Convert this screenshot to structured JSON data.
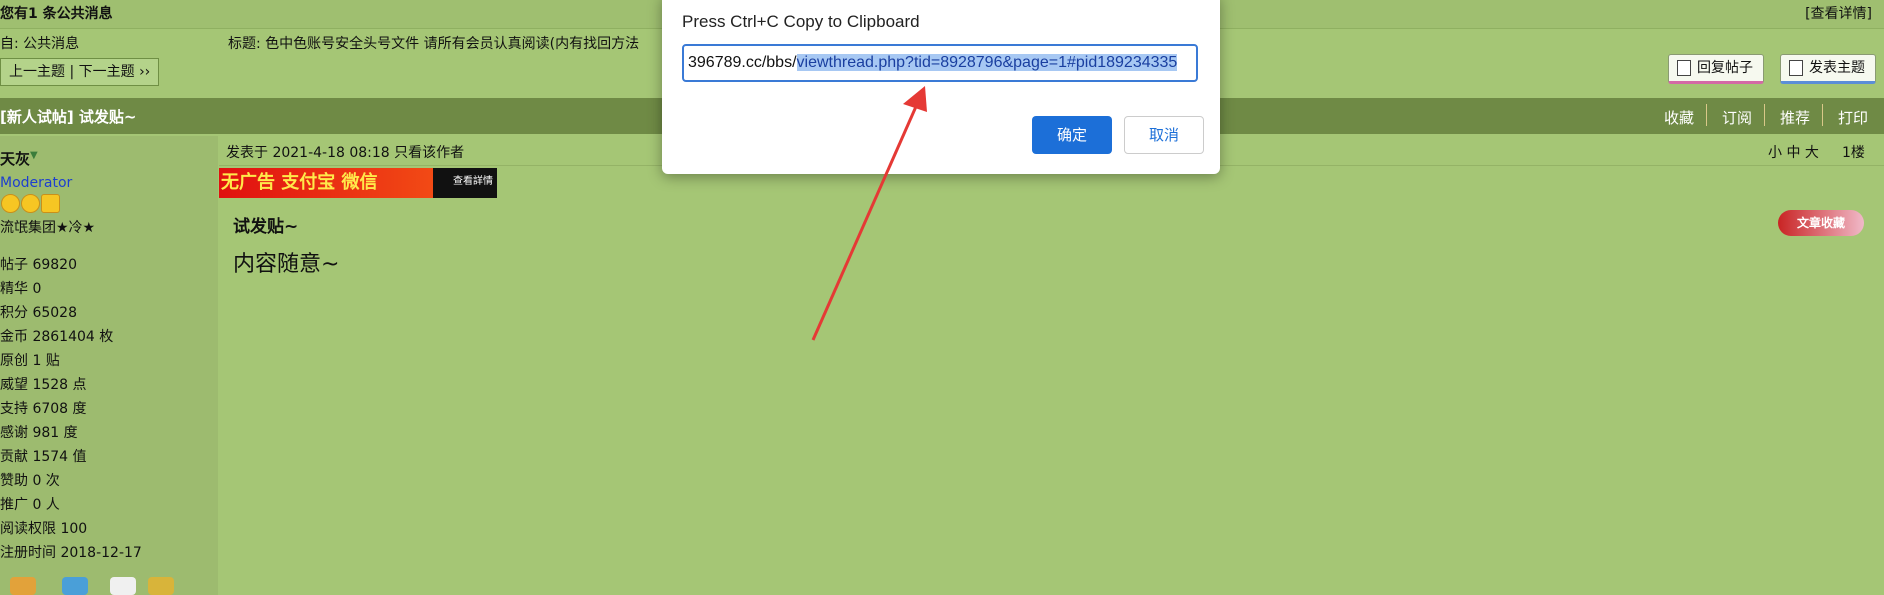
{
  "notice": {
    "title": "您有1 条公共消息",
    "detail": "[查看详情]",
    "from": "自: 公共消息",
    "subject": "标题: 色中色账号安全头号文件 请所有会员认真阅读(内有找回方法",
    "prev_next": "上一主题 | 下一主题 ››"
  },
  "actions": {
    "reply": "回复帖子",
    "post": "发表主题"
  },
  "thread": {
    "title": "[新人试帖] 试发贴~",
    "links": [
      "收藏",
      "订阅",
      "推荐",
      "打印"
    ]
  },
  "user": {
    "name": "天灰",
    "group": "Moderator",
    "team": "流氓集团★冷★",
    "stats": [
      "帖子  69820",
      "精华  0",
      "积分  65028",
      "金币  2861404 枚",
      "原创  1 贴",
      "威望  1528 点",
      "支持  6708 度",
      "感谢  981 度",
      "贡献  1574 值",
      "赞助  0 次",
      "推广  0 人",
      "阅读权限  100",
      "注册时间  2018-12-17"
    ]
  },
  "post": {
    "date": "发表于 2021-4-18 08:18  只看该作者",
    "font_sizes": "小 中 大",
    "floor": "1楼",
    "ad_text": "无广告 支付宝 微信",
    "ad_view": "查看詳情",
    "heading": "试发贴~",
    "body": "内容随意~",
    "share_badge": "文章收藏"
  },
  "dialog": {
    "title": "Press Ctrl+C Copy to Clipboard",
    "url_prefix": "396789.cc/bbs/",
    "url_selected": "viewthread.php?tid=8928796&page=1#pid189234335",
    "ok": "确定",
    "cancel": "取消"
  },
  "colors": {
    "page_bg": "#a5c675",
    "header_bar": "#6f8a45",
    "dialog_ok": "#1c6fd8",
    "arrow": "#e53935"
  }
}
